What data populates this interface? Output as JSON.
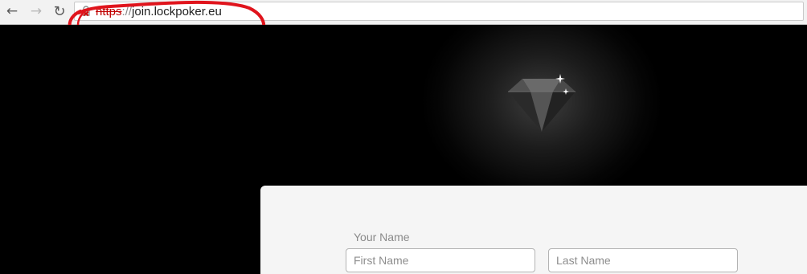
{
  "browser": {
    "nav": {
      "back_icon": "back-arrow-icon",
      "forward_icon": "forward-arrow-icon",
      "reload_icon": "reload-icon"
    },
    "url": {
      "scheme": "https",
      "separator": "://",
      "host": "join.lockpoker.eu"
    },
    "security_icon": "broken-lock-icon",
    "annotation_color": "#e0141c"
  },
  "hero": {
    "logo_icon": "diamond-icon"
  },
  "form": {
    "your_name_label": "Your Name",
    "first_name_placeholder": "First Name",
    "last_name_placeholder": "Last Name"
  }
}
